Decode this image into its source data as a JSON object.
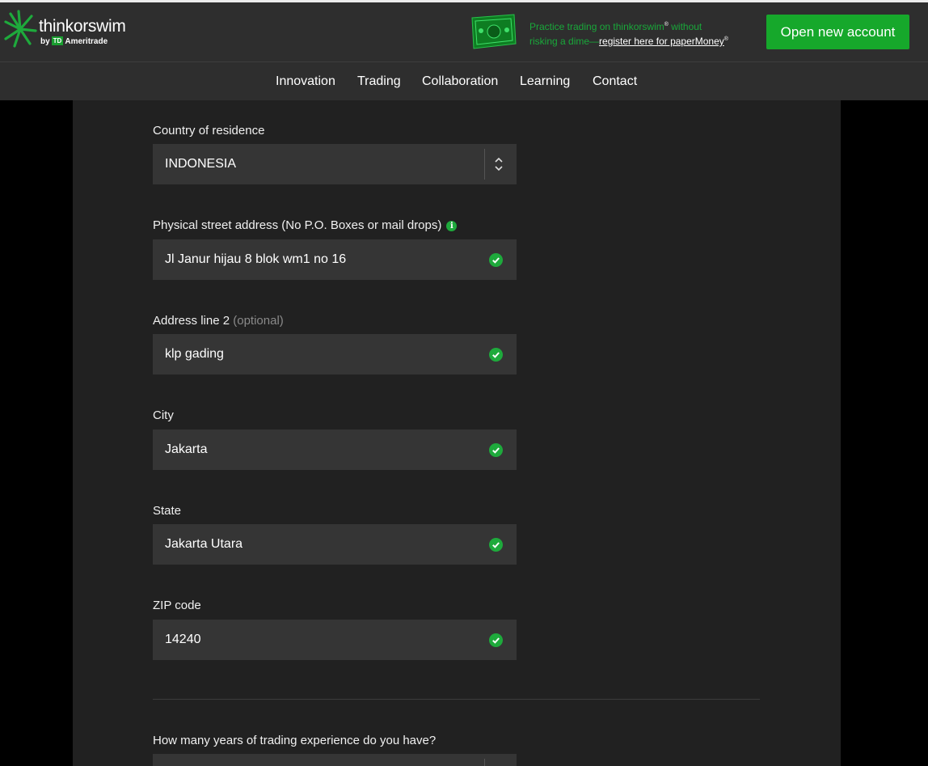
{
  "brand": {
    "name": "thinkorswim",
    "by": "by",
    "td": "TD",
    "ameritrade": "Ameritrade"
  },
  "promo": {
    "line1": "Practice trading on thinkorswim",
    "tm": "®",
    "without": " without",
    "line2": "risking a dime—",
    "link": "register here for paperMoney",
    "reg": "®"
  },
  "header": {
    "open_account": "Open new account"
  },
  "nav": [
    "Innovation",
    "Trading",
    "Collaboration",
    "Learning",
    "Contact"
  ],
  "form": {
    "country": {
      "label": "Country of residence",
      "value": "INDONESIA"
    },
    "street": {
      "label": "Physical street address (No P.O. Boxes or mail drops)",
      "info": "i",
      "value": "Jl Janur hijau 8 blok wm1 no 16"
    },
    "address2": {
      "label": "Address line 2",
      "optional": "(optional)",
      "value": "klp gading"
    },
    "city": {
      "label": "City",
      "value": "Jakarta"
    },
    "state": {
      "label": "State",
      "value": "Jakarta Utara"
    },
    "zip": {
      "label": "ZIP code",
      "value": "14240"
    },
    "experience": {
      "label": "How many years of trading experience do you have?"
    }
  },
  "colors": {
    "accent": "#16a82b",
    "check": "#1eaa3c",
    "panel": "#212121",
    "field": "#353535"
  }
}
